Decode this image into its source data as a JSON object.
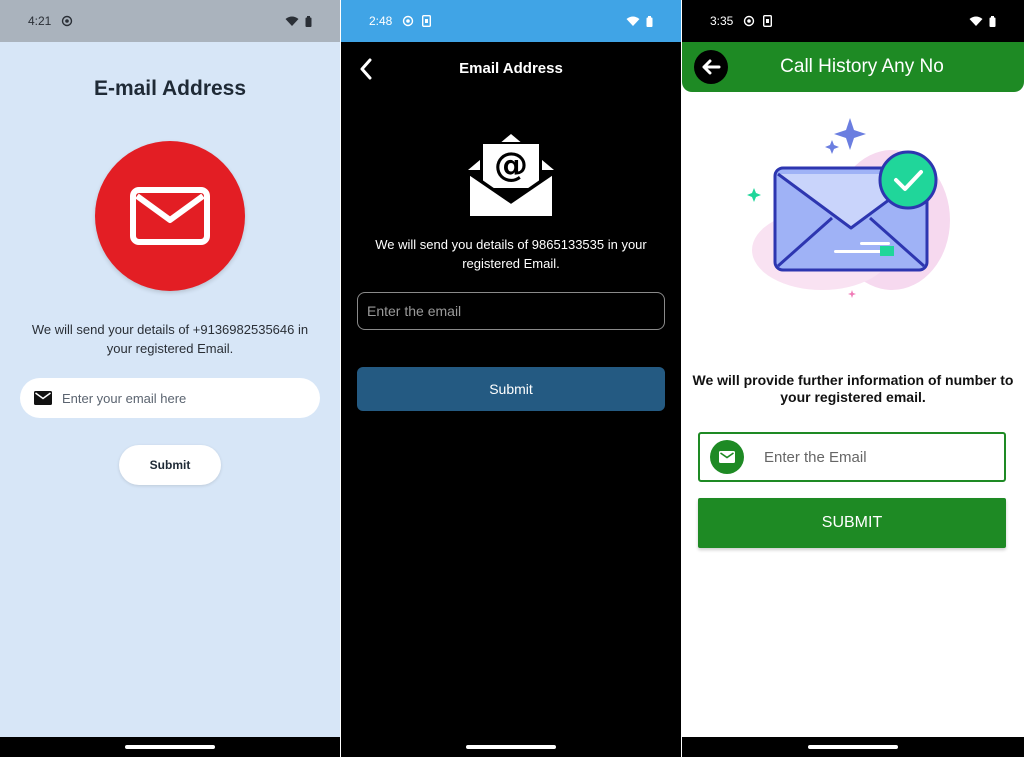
{
  "screen1": {
    "status": {
      "time": "4:21"
    },
    "title": "E-mail Address",
    "description": "We will send your details of +9136982535646 in your registered Email.",
    "email_placeholder": "Enter your email here",
    "submit_label": "Submit",
    "colors": {
      "background": "#d7e6f7",
      "accent": "#e31e24"
    }
  },
  "screen2": {
    "status": {
      "time": "2:48"
    },
    "header_title": "Email Address",
    "description": "We will send you details of 9865133535 in your registered Email.",
    "email_placeholder": "Enter the email",
    "submit_label": "Submit",
    "colors": {
      "statusbar": "#40a4e6",
      "button": "#245a82"
    }
  },
  "screen3": {
    "status": {
      "time": "3:35"
    },
    "header_title": "Call History Any No",
    "description": "We will provide further information of number to your registered email.",
    "email_placeholder": "Enter the Email",
    "submit_label": "SUBMIT",
    "colors": {
      "primary": "#1e8a24",
      "check": "#20d69a"
    }
  },
  "icons": [
    "back-arrow-icon",
    "mail-icon",
    "envelope-at-icon",
    "email-check-illustration",
    "wifi-icon",
    "battery-icon"
  ]
}
